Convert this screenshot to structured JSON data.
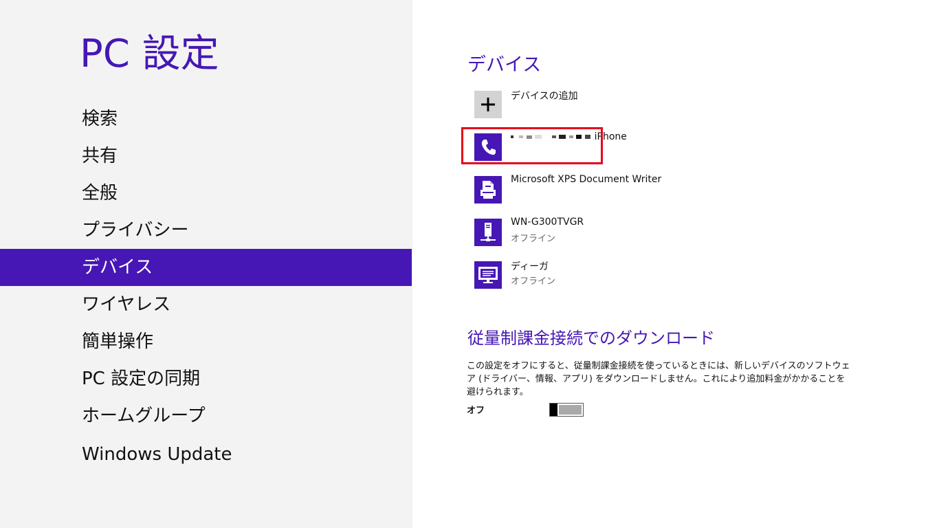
{
  "sidebar": {
    "title": "PC 設定",
    "items": [
      {
        "label": "検索"
      },
      {
        "label": "共有"
      },
      {
        "label": "全般"
      },
      {
        "label": "プライバシー"
      },
      {
        "label": "デバイス",
        "selected": true
      },
      {
        "label": "ワイヤレス"
      },
      {
        "label": "簡単操作"
      },
      {
        "label": "PC 設定の同期"
      },
      {
        "label": "ホームグループ"
      },
      {
        "label": "Windows Update"
      }
    ]
  },
  "devices": {
    "title": "デバイス",
    "add": {
      "label": "デバイスの追加",
      "icon": "plus-icon"
    },
    "list": [
      {
        "name": "iPhone",
        "status": "",
        "icon": "phone-icon",
        "highlighted": true
      },
      {
        "name": "Microsoft XPS Document Writer",
        "status": "",
        "icon": "printer-icon"
      },
      {
        "name": "WN-G300TVGR",
        "status": "オフライン",
        "icon": "network-device-icon"
      },
      {
        "name": "ディーガ",
        "status": "オフライン",
        "icon": "monitor-icon"
      }
    ]
  },
  "metered": {
    "title": "従量制課金接続でのダウンロード",
    "description": "この設定をオフにすると、従量制課金接続を使っているときには、新しいデバイスのソフトウェア (ドライバー、情報、アプリ) をダウンロードしません。これにより追加料金がかかることを避けられます。",
    "toggle_label": "オフ",
    "toggle_state": "off"
  },
  "colors": {
    "accent": "#4617b4",
    "highlight": "#e6001c",
    "sidebar_bg": "#f3f3f3"
  }
}
